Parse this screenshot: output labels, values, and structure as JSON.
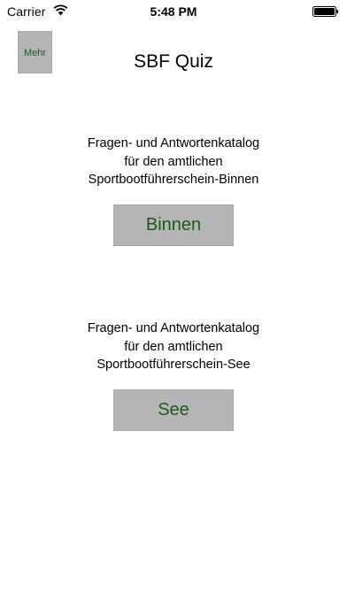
{
  "status_bar": {
    "carrier": "Carrier",
    "time": "5:48 PM",
    "wifi_icon": "wifi-icon",
    "battery_icon": "battery-icon"
  },
  "nav": {
    "more_label": "Mehr",
    "title": "SBF Quiz"
  },
  "sections": [
    {
      "lines": [
        "Fragen- und Antwortenkatalog",
        "für den amtlichen",
        "Sportbootführerschein-Binnen"
      ],
      "button_label": "Binnen"
    },
    {
      "lines": [
        "Fragen- und Antwortenkatalog",
        "für den amtlichen",
        "Sportbootführerschein-See"
      ],
      "button_label": "See"
    }
  ],
  "colors": {
    "button_background": "#b5b5b5",
    "button_text": "#1c5a1c",
    "background": "#ffffff"
  }
}
